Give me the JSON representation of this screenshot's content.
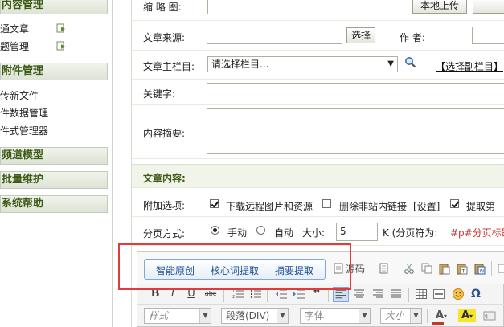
{
  "sidebar": {
    "section1": "内容管理",
    "items1": [
      "通文章",
      "题管理"
    ],
    "section2": "附件管理",
    "items2": [
      "传新文件",
      "件数据管理",
      "件式管理器"
    ],
    "section3": "频道模型",
    "section4": "批量维护",
    "section5": "系统帮助"
  },
  "form": {
    "thumb_label": "缩 略 图:",
    "upload_button": "本地上传",
    "source_label": "文章来源:",
    "select_button": "选择",
    "author_label": "作  者:",
    "column_label": "文章主栏目:",
    "column_select": "请选择栏目...",
    "sub_column_link": "【选择副栏目】",
    "keywords_label": "关键字:",
    "summary_label": "内容摘要:",
    "content_section": "文章内容:",
    "options_label": "附加选项:",
    "option_download": "下载远程图片和资源",
    "option_remove_links": "删除非站内链接",
    "option_settings": "[设置]",
    "option_extract": "提取第一",
    "paging_label": "分页方式:",
    "paging_manual": "手动",
    "paging_auto": "自动",
    "size_label": "大小:",
    "size_value": "5",
    "size_unit": "K (分页符为:",
    "page_break_code": "#p#分页标题"
  },
  "editor": {
    "plugins": [
      "智能原创",
      "核心词提取",
      "摘要提取"
    ],
    "source_label": "源码",
    "style_combo": "样式",
    "paragraph_combo": "段落(DIV)",
    "font_combo": "字体",
    "size_combo": "大小"
  },
  "colors": {
    "sidebar_header_text": "#3d5a16",
    "highlight": "#e23b3b",
    "plugin_text": "#1f4f96"
  }
}
